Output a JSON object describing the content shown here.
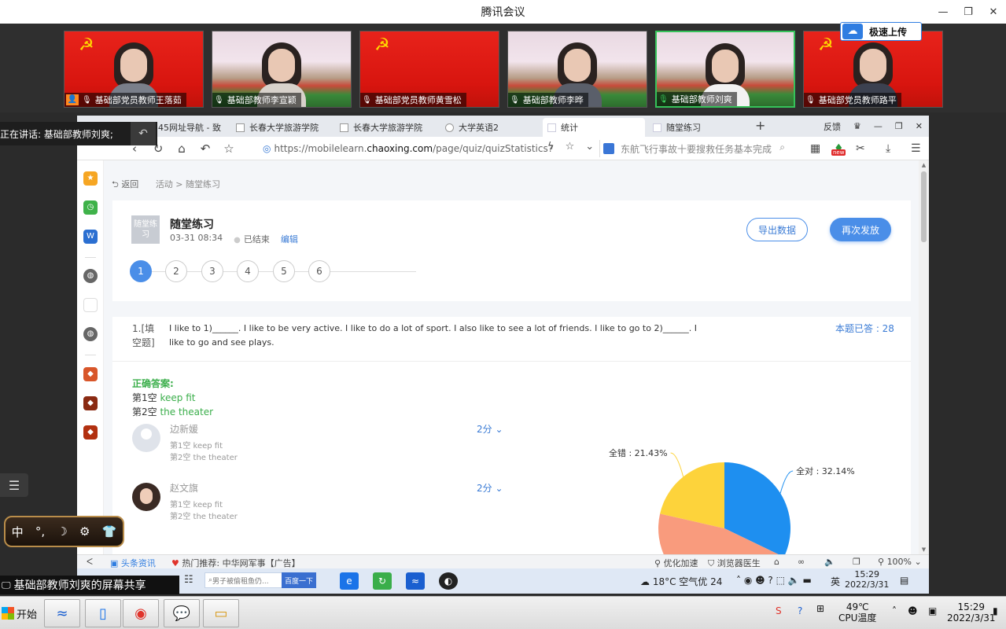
{
  "meeting": {
    "title": "腾讯会议",
    "window_controls": [
      "—",
      "❐",
      "✕"
    ],
    "upload_badge": "极速上传",
    "participants": [
      {
        "name": "基础部党员教师王落茹",
        "background": "flag",
        "host": true,
        "mic_on": false
      },
      {
        "name": "基础部教师李宣颖",
        "background": "campus",
        "host": false,
        "mic_on": false
      },
      {
        "name": "基础部党员教师黄雪松",
        "background": "flag",
        "host": false,
        "mic_on": false
      },
      {
        "name": "基础部教师李晔",
        "background": "campus",
        "host": false,
        "mic_on": false
      },
      {
        "name": "基础部教师刘爽",
        "background": "campus",
        "host": false,
        "mic_on": true,
        "active": true
      },
      {
        "name": "基础部党员教师路平",
        "background": "flag",
        "host": false,
        "mic_on": false
      }
    ],
    "speaking": "正在讲话: 基础部教师刘爽;",
    "screen_share": "基础部教师刘爽的屏幕共享",
    "ime": [
      "中",
      "°,",
      "☽",
      "⚙",
      "👕"
    ]
  },
  "browser": {
    "tabs": [
      {
        "label": "345网址导航 - 致"
      },
      {
        "label": "长春大学旅游学院"
      },
      {
        "label": "长春大学旅游学院"
      },
      {
        "label": "大学英语2"
      },
      {
        "label": "统计",
        "active": true
      },
      {
        "label": "随堂练习"
      }
    ],
    "tab_right": [
      "反馈",
      "♛",
      "—",
      "❐",
      "✕"
    ],
    "url_prefix": "https://mobilelearn.",
    "url_domain": "chaoxing.com",
    "url_path": "/page/quiz/quizStatistics?",
    "search_text": "东航飞行事故十要搜救任务基本完成",
    "new_badge": "new",
    "status": {
      "news": "头条资讯",
      "hot": "热门推荐: 中华网军事【广告】",
      "speed": "优化加速",
      "doctor": "浏览器医生",
      "zoom": "100%"
    }
  },
  "page": {
    "back": "返回",
    "crumb_activity": "活动",
    "crumb_current": "随堂练习",
    "quiz_thumb": "随堂练习",
    "quiz_title": "随堂练习",
    "quiz_time": "03-31 08:34",
    "quiz_status": "已结束",
    "quiz_edit": "编辑",
    "export_button": "导出数据",
    "resend_button": "再次发放",
    "steps": [
      "1",
      "2",
      "3",
      "4",
      "5",
      "6"
    ],
    "question": {
      "number": "1.[填空题]",
      "text": "I like to 1)______. I like to be very active. I like to do a lot of sport. I also like to see a lot of friends. I like to go to 2)______. I like to go and see plays.",
      "answered": "本题已答 : 28"
    },
    "correct_heading": "正确答案:",
    "correct_answers": [
      {
        "blank": "第1空",
        "answer": "keep fit"
      },
      {
        "blank": "第2空",
        "answer": "the theater"
      }
    ],
    "students": [
      {
        "name": "边新媛",
        "a1": "第1空  keep fit",
        "a2": "第2空  the theater",
        "score": "2分 ⌄",
        "avatar": "blank"
      },
      {
        "name": "赵文旗",
        "a1": "第1空  keep fit",
        "a2": "第2空  the theater",
        "score": "2分 ⌄",
        "avatar": "photo"
      }
    ]
  },
  "chart_data": {
    "type": "pie",
    "title": "",
    "slices": [
      {
        "label": "全对 : 32.14%",
        "value": 32.14,
        "color": "#1e8ff0"
      },
      {
        "label": "",
        "value": 46.43,
        "color": "#f99b7d"
      },
      {
        "label": "全错 : 21.43%",
        "value": 21.43,
        "color": "#fdd33b"
      }
    ]
  },
  "inner_taskbar": {
    "search_placeholder": "男子被偷租鱼仍...",
    "search_button": "百度一下",
    "weather": "18°C  空气优 24",
    "lang": "英",
    "time": "15:29",
    "date": "2022/3/31"
  },
  "taskbar": {
    "start": "开始",
    "cpu_temp": "49℃",
    "cpu_label": "CPU温度",
    "time": "15:29",
    "date": "2022/3/31"
  }
}
